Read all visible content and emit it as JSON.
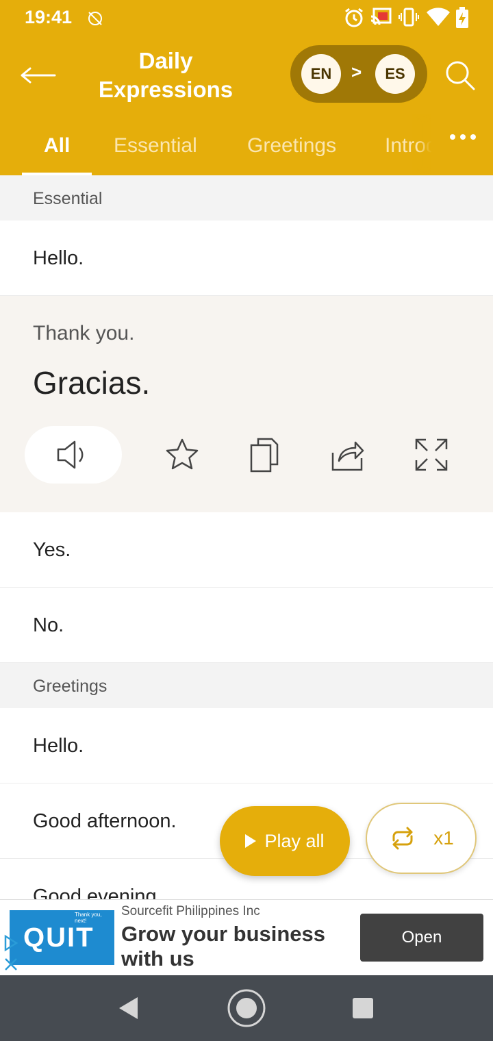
{
  "status_bar": {
    "time": "19:41",
    "left_icons": [
      "no-location-icon"
    ],
    "right_icons": [
      "alarm-icon",
      "cast-icon",
      "vibrate-icon",
      "wifi-icon",
      "battery-charging-icon"
    ]
  },
  "app_bar": {
    "title": "Daily Expressions",
    "back_icon": "back-arrow-icon",
    "search_icon": "search-icon",
    "source_lang": "EN",
    "separator": ">",
    "target_lang": "ES",
    "accent_color": "#E5AE0B"
  },
  "tabs": [
    {
      "label": "All",
      "active": true
    },
    {
      "label": "Essential",
      "active": false
    },
    {
      "label": "Greetings",
      "active": false
    },
    {
      "label": "Introductions",
      "active": false
    }
  ],
  "tabs_more_icon": "more-horizontal-icon",
  "sections": [
    {
      "header": "Essential",
      "rows": [
        {
          "text": "Hello."
        },
        {
          "text": "Thank you.",
          "translation": "Gracias.",
          "expanded": true
        },
        {
          "text": "Yes."
        },
        {
          "text": "No."
        }
      ]
    },
    {
      "header": "Greetings",
      "rows": [
        {
          "text": "Hello."
        },
        {
          "text": "Good afternoon."
        },
        {
          "text": "Good evening."
        }
      ]
    }
  ],
  "expanded_actions": [
    "speaker-icon",
    "star-icon",
    "copy-icon",
    "share-icon",
    "fullscreen-icon"
  ],
  "play_all": {
    "label": "Play all",
    "icon": "play-icon"
  },
  "repeat": {
    "label": "x1",
    "icon": "repeat-icon"
  },
  "ad": {
    "advertiser": "Sourcefit Philippines Inc",
    "headline": "Grow your business with us",
    "button": "Open",
    "thumb_text": "QUIT",
    "thumb_caption": "Thank you, next!",
    "marks": [
      "ad-choices-icon",
      "close-icon"
    ]
  },
  "nav_bar": {
    "icons": [
      "nav-back-icon",
      "nav-home-icon",
      "nav-recents-icon"
    ]
  }
}
